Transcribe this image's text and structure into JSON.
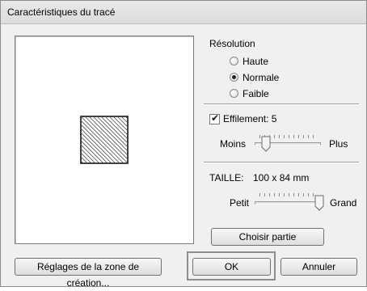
{
  "dialog": {
    "title": "Caractéristiques du tracé"
  },
  "resolution": {
    "label": "Résolution",
    "options": [
      "Haute",
      "Normale",
      "Faible"
    ],
    "selected": "Normale"
  },
  "taper": {
    "label": "Effilement: 5",
    "checked": true,
    "min_label": "Moins",
    "max_label": "Plus",
    "level_fraction": 0.15
  },
  "size": {
    "label": "TAILLE:",
    "value": "100 x 84 mm",
    "min_label": "Petit",
    "max_label": "Grand",
    "level_fraction": 1.0
  },
  "buttons": {
    "choose_part": "Choisir partie",
    "settings": "Réglages de la zone de création...",
    "ok": "OK",
    "cancel": "Annuler"
  }
}
